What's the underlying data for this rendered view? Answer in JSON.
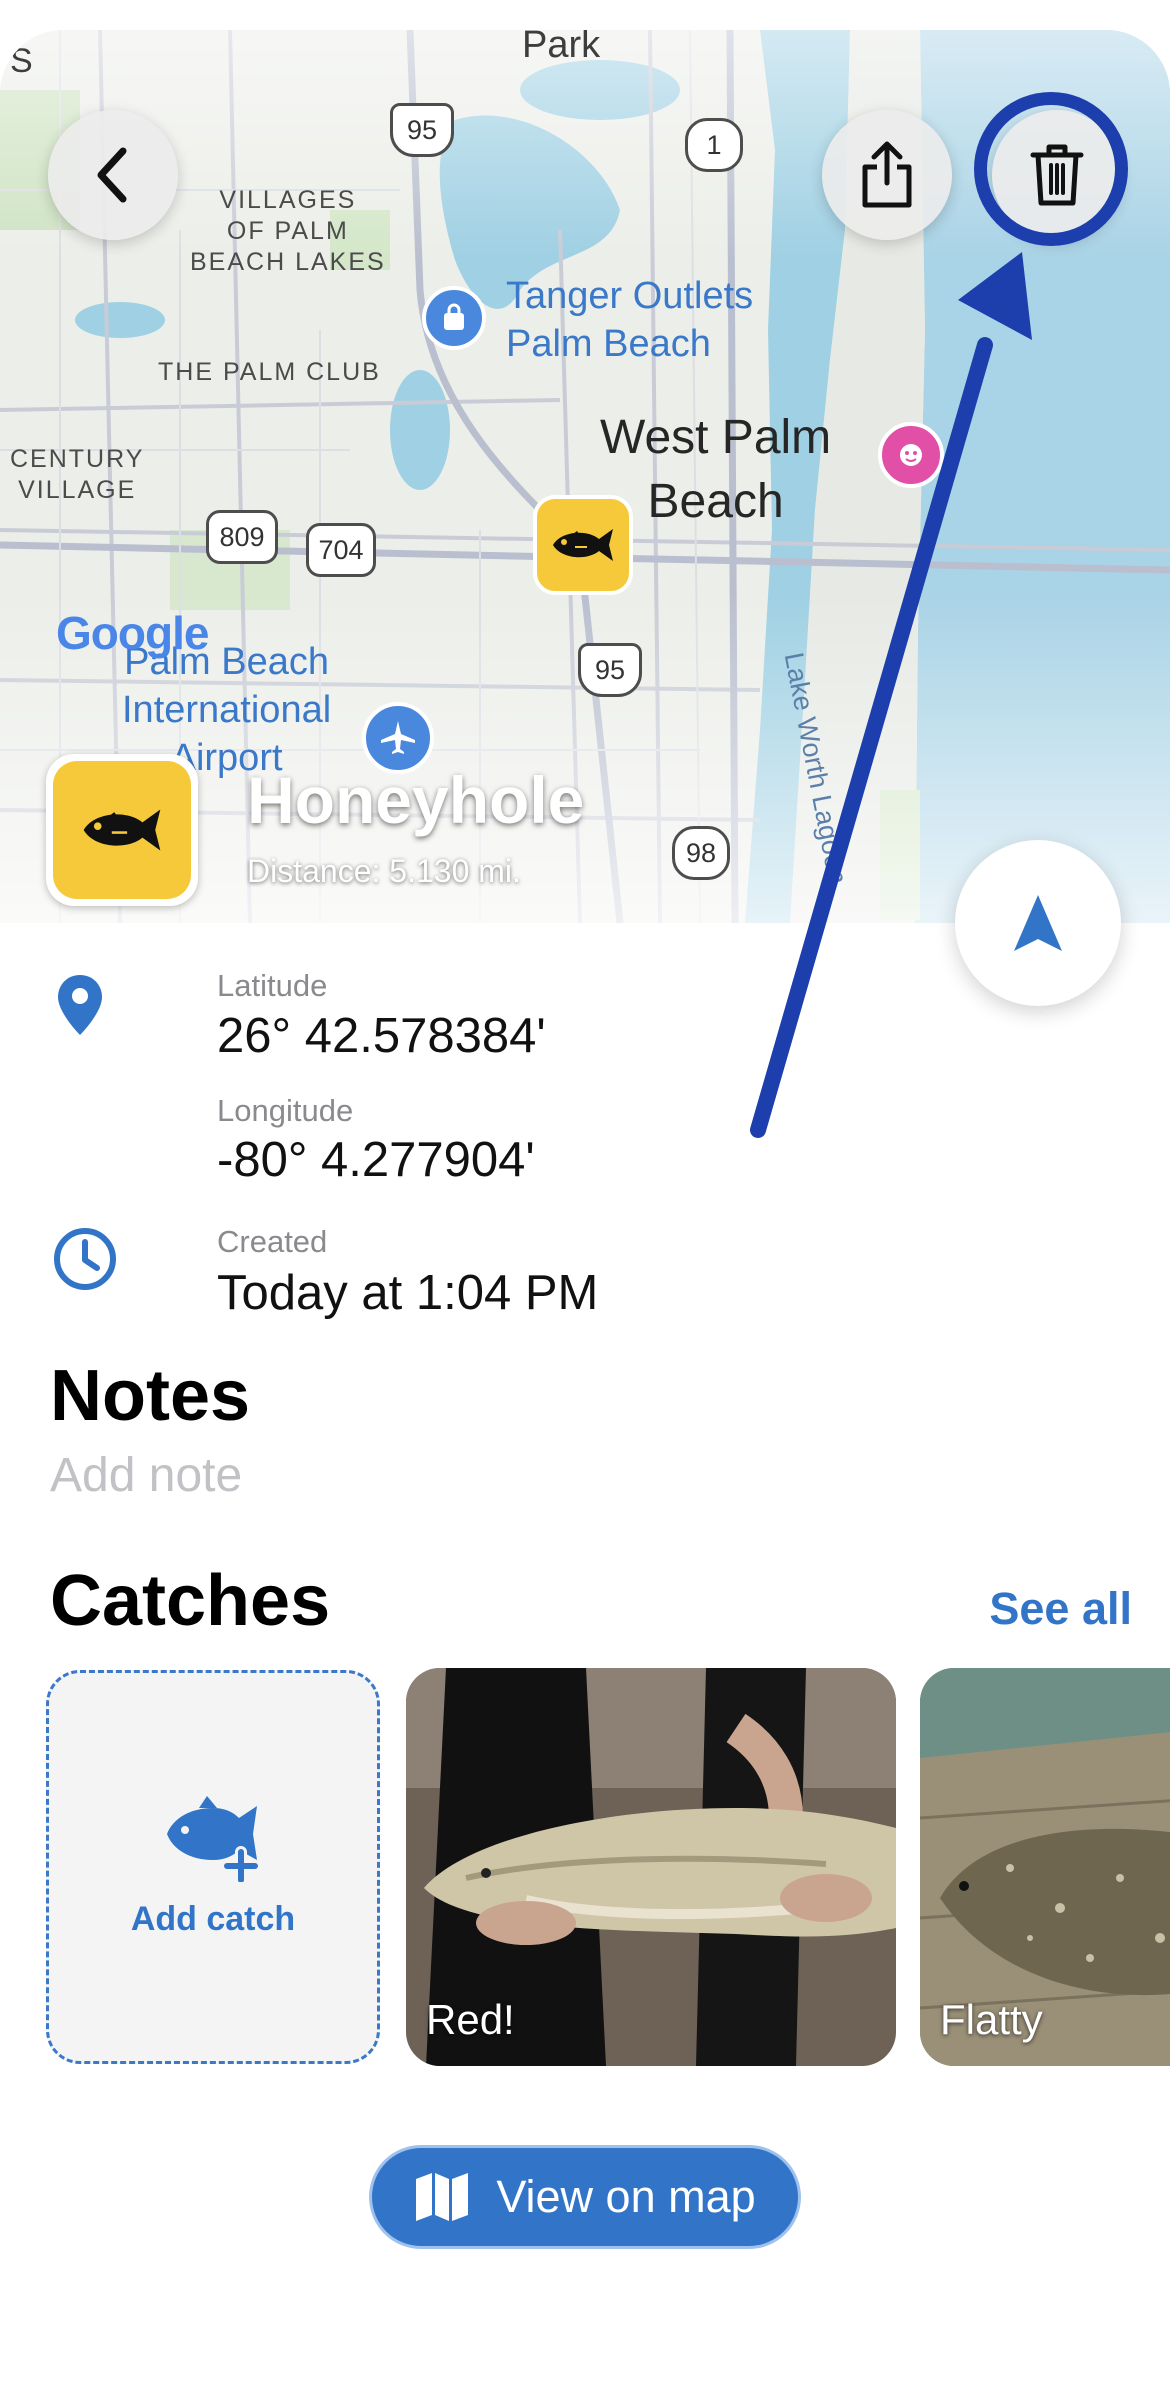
{
  "map": {
    "labels": {
      "park": "Park",
      "s_fragment": "S",
      "villages": "VILLAGES\nOF PALM\nBEACH LAKES",
      "palm_club": "THE PALM CLUB",
      "century": "CENTURY\nVILLAGE",
      "tanger": "Tanger Outlets\nPalm Beach",
      "west_palm": "West Palm\nBeach",
      "airport": "Palm Beach\nInternational\nAirport",
      "lake_worth": "Lake Worth Lagoon",
      "google": "Google"
    },
    "shields": {
      "i95_top": "95",
      "us1": "1",
      "r809": "809",
      "r704": "704",
      "i95_mid": "95",
      "r98": "98"
    }
  },
  "spot": {
    "title": "Honeyhole",
    "distance": "Distance: 5.130 mi."
  },
  "details": {
    "latitude_label": "Latitude",
    "latitude_value": "26° 42.578384'",
    "longitude_label": "Longitude",
    "longitude_value": "-80° 4.277904'",
    "created_label": "Created",
    "created_value": "Today at 1:04 PM"
  },
  "notes": {
    "heading": "Notes",
    "placeholder": "Add note"
  },
  "catches": {
    "heading": "Catches",
    "see_all": "See all",
    "add_label": "Add catch",
    "items": [
      {
        "name": "Red!"
      },
      {
        "name": "Flatty"
      }
    ]
  },
  "actions": {
    "view_on_map": "View on map"
  },
  "colors": {
    "accent": "#3275c8",
    "spot_yellow": "#f6c93a",
    "annotation": "#1d3fae"
  },
  "icons": [
    "back-chevron-icon",
    "share-icon",
    "trash-icon",
    "fish-icon",
    "navigate-arrow-icon",
    "location-pin-icon",
    "clock-icon",
    "fish-plus-icon",
    "map-icon"
  ]
}
